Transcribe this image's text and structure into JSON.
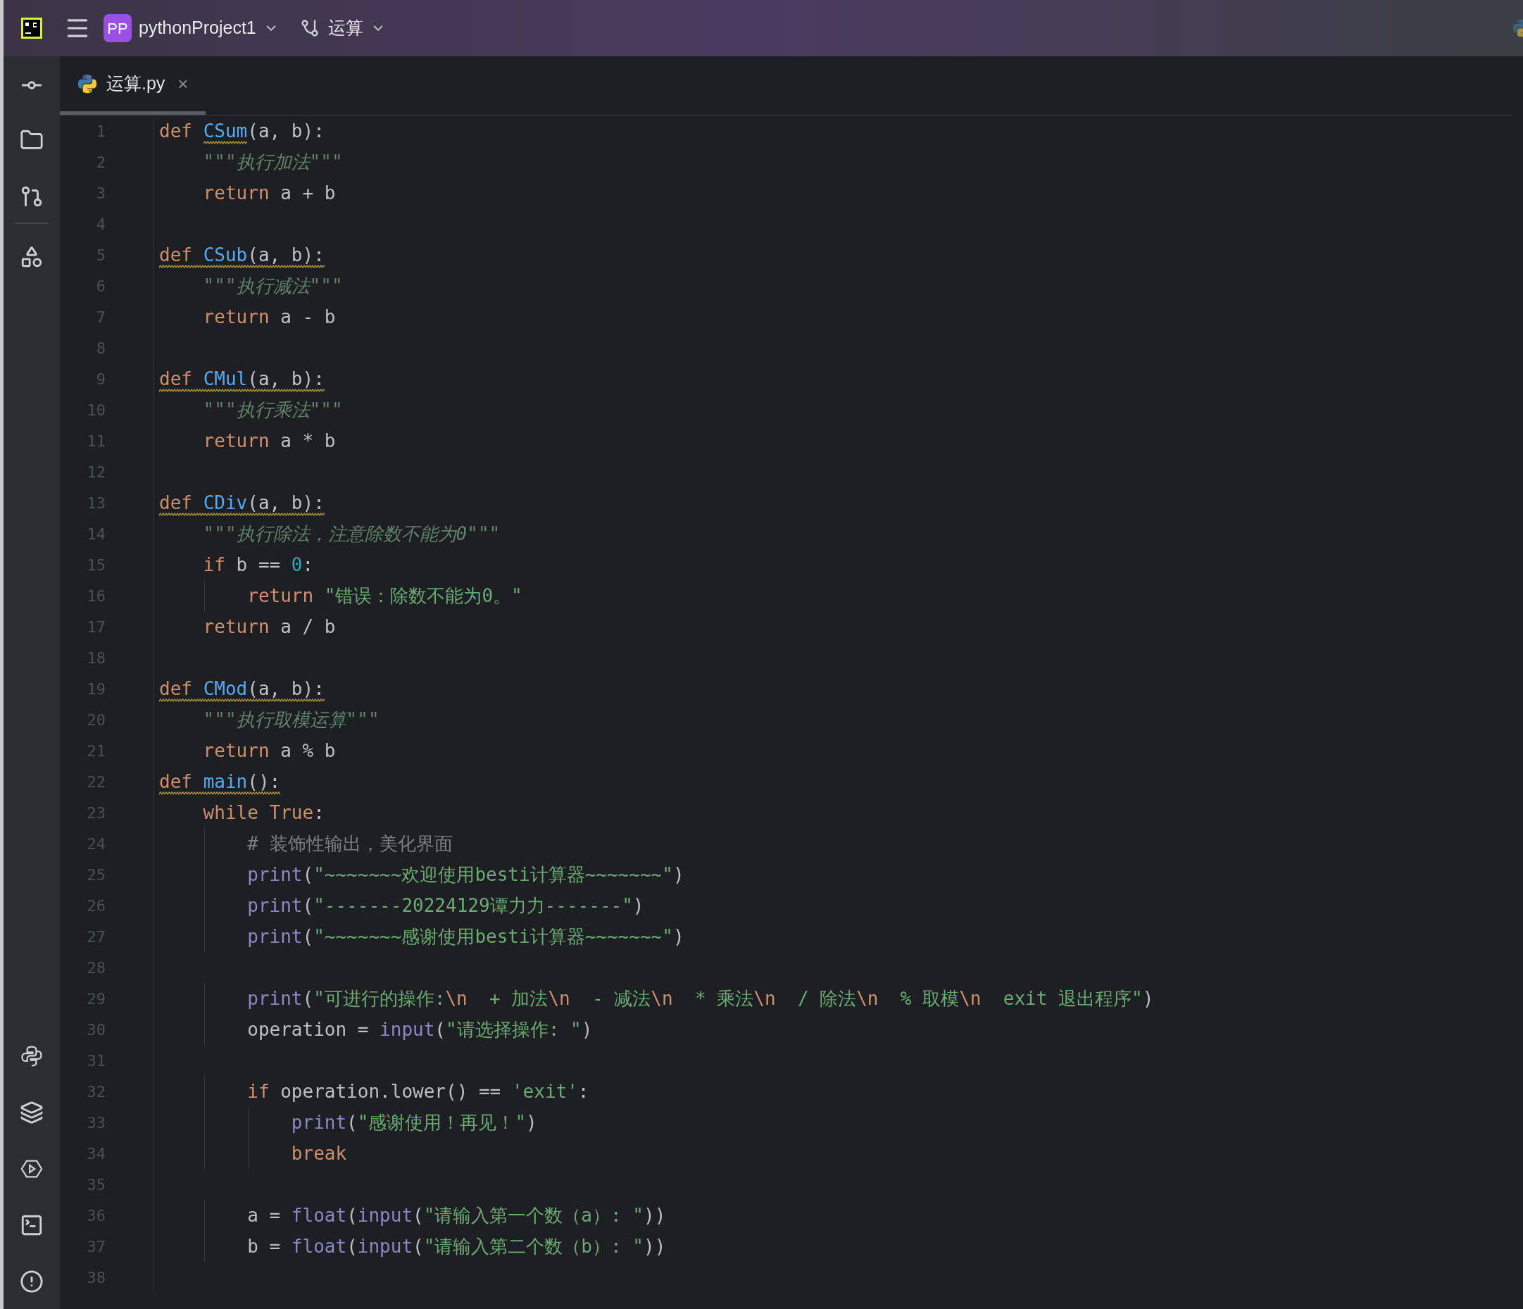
{
  "header": {
    "project_badge": "PP",
    "project": "pythonProject1",
    "branch": "运算"
  },
  "tabs": [
    {
      "label": "运算.py",
      "selected": true,
      "close": "×"
    }
  ],
  "editor": {
    "lines": [
      {
        "n": "1",
        "warning": false,
        "tokens": [
          {
            "kind": "keyword",
            "t": "def "
          },
          {
            "kind": "function",
            "t": "CSum",
            "warning": true
          },
          {
            "kind": "plain",
            "t": "(a, b):"
          }
        ]
      },
      {
        "n": "2",
        "warning": false,
        "tokens": [
          {
            "kind": "docstring",
            "t": "    \"\"\"执行加法\"\"\""
          }
        ]
      },
      {
        "n": "3",
        "warning": false,
        "tokens": [
          {
            "kind": "keyword",
            "t": "    return"
          },
          {
            "kind": "plain",
            "t": " a + b"
          }
        ]
      },
      {
        "n": "4"
      },
      {
        "n": "5",
        "warning": true,
        "tokens": [
          {
            "kind": "keyword",
            "t": "def "
          },
          {
            "kind": "function",
            "t": "CSub"
          },
          {
            "kind": "plain",
            "t": "(a, b):"
          }
        ]
      },
      {
        "n": "6",
        "warning": false,
        "tokens": [
          {
            "kind": "docstring",
            "t": "    \"\"\"执行减法\"\"\""
          }
        ]
      },
      {
        "n": "7",
        "warning": false,
        "tokens": [
          {
            "kind": "keyword",
            "t": "    return"
          },
          {
            "kind": "plain",
            "t": " a - b"
          }
        ]
      },
      {
        "n": "8"
      },
      {
        "n": "9",
        "warning": true,
        "tokens": [
          {
            "kind": "keyword",
            "t": "def "
          },
          {
            "kind": "function",
            "t": "CMul"
          },
          {
            "kind": "plain",
            "t": "(a, b):"
          }
        ]
      },
      {
        "n": "10",
        "warning": false,
        "tokens": [
          {
            "kind": "docstring",
            "t": "    \"\"\"执行乘法\"\"\""
          }
        ]
      },
      {
        "n": "11",
        "warning": false,
        "tokens": [
          {
            "kind": "keyword",
            "t": "    return"
          },
          {
            "kind": "plain",
            "t": " a * b"
          }
        ]
      },
      {
        "n": "12"
      },
      {
        "n": "13",
        "warning": true,
        "tokens": [
          {
            "kind": "keyword",
            "t": "def "
          },
          {
            "kind": "function",
            "t": "CDiv"
          },
          {
            "kind": "plain",
            "t": "(a, b):"
          }
        ]
      },
      {
        "n": "14",
        "warning": false,
        "tokens": [
          {
            "kind": "docstring",
            "t": "    \"\"\"执行除法，注意除数不能为0\"\"\""
          }
        ]
      },
      {
        "n": "15",
        "warning": false,
        "tokens": [
          {
            "kind": "keyword",
            "t": "    if"
          },
          {
            "kind": "plain",
            "t": " b == "
          },
          {
            "kind": "number",
            "t": "0"
          },
          {
            "kind": "plain",
            "t": ":"
          }
        ]
      },
      {
        "n": "16",
        "warning": false,
        "tokens": [
          {
            "kind": "keyword",
            "t": "        return"
          },
          {
            "kind": "string",
            "t": " \"错误：除数不能为0。\""
          }
        ]
      },
      {
        "n": "17",
        "warning": false,
        "tokens": [
          {
            "kind": "keyword",
            "t": "    return"
          },
          {
            "kind": "plain",
            "t": " a / b"
          }
        ]
      },
      {
        "n": "18"
      },
      {
        "n": "19",
        "warning": true,
        "tokens": [
          {
            "kind": "keyword",
            "t": "def "
          },
          {
            "kind": "function",
            "t": "CMod"
          },
          {
            "kind": "plain",
            "t": "(a, b):"
          }
        ]
      },
      {
        "n": "20",
        "warning": false,
        "tokens": [
          {
            "kind": "docstring",
            "t": "    \"\"\"执行取模运算\"\"\""
          }
        ]
      },
      {
        "n": "21",
        "warning": false,
        "tokens": [
          {
            "kind": "keyword",
            "t": "    return"
          },
          {
            "kind": "plain",
            "t": " a % b"
          }
        ]
      },
      {
        "n": "22",
        "warning": true,
        "tokens": [
          {
            "kind": "keyword",
            "t": "def "
          },
          {
            "kind": "function",
            "t": "main"
          },
          {
            "kind": "plain",
            "t": "():"
          }
        ]
      },
      {
        "n": "23",
        "warning": false,
        "tokens": [
          {
            "kind": "keyword",
            "t": "    while True"
          },
          {
            "kind": "plain",
            "t": ":"
          }
        ]
      },
      {
        "n": "24",
        "warning": false,
        "tokens": [
          {
            "kind": "comment",
            "t": "        # 装饰性输出，美化界面"
          }
        ]
      },
      {
        "n": "25",
        "warning": false,
        "tokens": [
          {
            "kind": "builtin",
            "t": "        print"
          },
          {
            "kind": "plain",
            "t": "("
          },
          {
            "kind": "string",
            "t": "\"~~~~~~~欢迎使用besti计算器~~~~~~~\""
          },
          {
            "kind": "plain",
            "t": ")"
          }
        ]
      },
      {
        "n": "26",
        "warning": false,
        "tokens": [
          {
            "kind": "builtin",
            "t": "        print"
          },
          {
            "kind": "plain",
            "t": "("
          },
          {
            "kind": "string",
            "t": "\"-------20224129谭力力-------\""
          },
          {
            "kind": "plain",
            "t": ")"
          }
        ]
      },
      {
        "n": "27",
        "warning": false,
        "tokens": [
          {
            "kind": "builtin",
            "t": "        print"
          },
          {
            "kind": "plain",
            "t": "("
          },
          {
            "kind": "string",
            "t": "\"~~~~~~~感谢使用besti计算器~~~~~~~\""
          },
          {
            "kind": "plain",
            "t": ")"
          }
        ]
      },
      {
        "n": "28"
      },
      {
        "n": "29",
        "warning": false,
        "tokens": [
          {
            "kind": "builtin",
            "t": "        print"
          },
          {
            "kind": "plain",
            "t": "("
          },
          {
            "kind": "string",
            "t": "\"可进行的操作:"
          },
          {
            "kind": "escape",
            "t": "\\n"
          },
          {
            "kind": "string",
            "t": "  + 加法"
          },
          {
            "kind": "escape",
            "t": "\\n"
          },
          {
            "kind": "string",
            "t": "  - 减法"
          },
          {
            "kind": "escape",
            "t": "\\n"
          },
          {
            "kind": "string",
            "t": "  * 乘法"
          },
          {
            "kind": "escape",
            "t": "\\n"
          },
          {
            "kind": "string",
            "t": "  / 除法"
          },
          {
            "kind": "escape",
            "t": "\\n"
          },
          {
            "kind": "string",
            "t": "  % 取模"
          },
          {
            "kind": "escape",
            "t": "\\n"
          },
          {
            "kind": "string",
            "t": "  exit 退出程序\""
          },
          {
            "kind": "plain",
            "t": ")"
          }
        ]
      },
      {
        "n": "30",
        "warning": false,
        "tokens": [
          {
            "kind": "plain",
            "t": "        operation = "
          },
          {
            "kind": "builtin",
            "t": "input"
          },
          {
            "kind": "plain",
            "t": "("
          },
          {
            "kind": "string",
            "t": "\"请选择操作: \""
          },
          {
            "kind": "plain",
            "t": ")"
          }
        ]
      },
      {
        "n": "31"
      },
      {
        "n": "32",
        "warning": false,
        "tokens": [
          {
            "kind": "keyword",
            "t": "        if"
          },
          {
            "kind": "plain",
            "t": " operation.lower() == "
          },
          {
            "kind": "string",
            "t": "'exit'"
          },
          {
            "kind": "plain",
            "t": ":"
          }
        ]
      },
      {
        "n": "33",
        "warning": false,
        "tokens": [
          {
            "kind": "builtin",
            "t": "            print"
          },
          {
            "kind": "plain",
            "t": "("
          },
          {
            "kind": "string",
            "t": "\"感谢使用！再见！\""
          },
          {
            "kind": "plain",
            "t": ")"
          }
        ]
      },
      {
        "n": "34",
        "warning": false,
        "tokens": [
          {
            "kind": "keyword",
            "t": "            break"
          }
        ]
      },
      {
        "n": "35"
      },
      {
        "n": "36",
        "warning": false,
        "tokens": [
          {
            "kind": "plain",
            "t": "        a = "
          },
          {
            "kind": "builtin",
            "t": "float"
          },
          {
            "kind": "plain",
            "t": "("
          },
          {
            "kind": "builtin",
            "t": "input"
          },
          {
            "kind": "plain",
            "t": "("
          },
          {
            "kind": "string",
            "t": "\"请输入第一个数（a）: \""
          },
          {
            "kind": "plain",
            "t": "))"
          }
        ]
      },
      {
        "n": "37",
        "warning": false,
        "tokens": [
          {
            "kind": "plain",
            "t": "        b = "
          },
          {
            "kind": "builtin",
            "t": "float"
          },
          {
            "kind": "plain",
            "t": "("
          },
          {
            "kind": "builtin",
            "t": "input"
          },
          {
            "kind": "plain",
            "t": "("
          },
          {
            "kind": "string",
            "t": "\"请输入第二个数（b）: \""
          },
          {
            "kind": "plain",
            "t": "))"
          }
        ]
      },
      {
        "n": "38"
      }
    ]
  }
}
